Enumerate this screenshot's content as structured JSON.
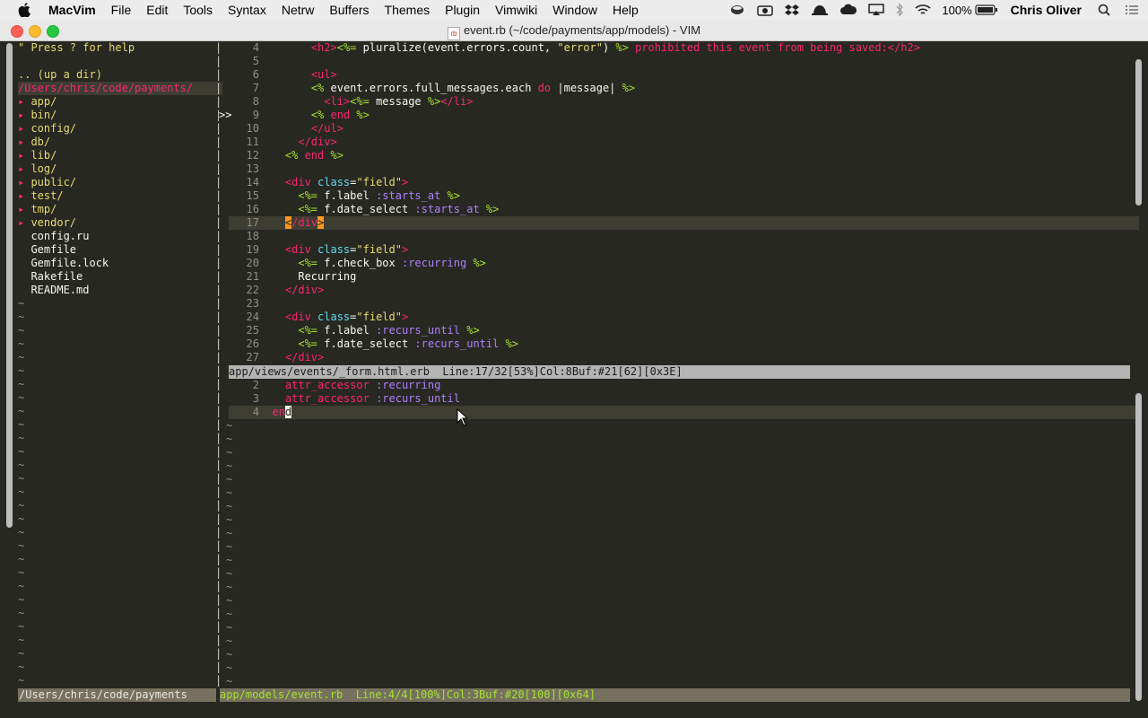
{
  "menubar": {
    "apple": "apple-icon",
    "items": [
      "MacVim",
      "File",
      "Edit",
      "Tools",
      "Syntax",
      "Netrw",
      "Buffers",
      "Themes",
      "Plugin",
      "Vimwiki",
      "Window",
      "Help"
    ],
    "battery": "100%",
    "user": "Chris Oliver"
  },
  "window": {
    "title": "event.rb (~/code/payments/app/models) - VIM",
    "file_badge": "rb"
  },
  "tree": {
    "help": "\" Press ? for help",
    "updir": ".. (up a dir)",
    "root": "/Users/chris/code/payments/",
    "dirs": [
      "app/",
      "bin/",
      "config/",
      "db/",
      "lib/",
      "log/",
      "public/",
      "test/",
      "tmp/",
      "vendor/"
    ],
    "files": [
      "config.ru",
      "Gemfile",
      "Gemfile.lock",
      "Rakefile",
      "README.md"
    ],
    "statusline": "/Users/chris/code/payments"
  },
  "top_buffer": {
    "cursor_marker": ">>",
    "lines": [
      {
        "n": "4",
        "segs": [
          [
            "k-txt",
            "      "
          ],
          [
            "k-tag",
            "<h2>"
          ],
          [
            "k-erb",
            "<%="
          ],
          [
            "k-txt",
            " pluralize(event.errors.count, "
          ],
          [
            "k-str",
            "\"error\""
          ],
          [
            "k-txt",
            ") "
          ],
          [
            "k-erb",
            "%>"
          ],
          [
            "k-red",
            " prohibited this event from being saved:"
          ],
          [
            "k-tag",
            "</h2>"
          ]
        ]
      },
      {
        "n": "5",
        "segs": []
      },
      {
        "n": "6",
        "segs": [
          [
            "k-txt",
            "      "
          ],
          [
            "k-tag",
            "<ul>"
          ]
        ]
      },
      {
        "n": "7",
        "segs": [
          [
            "k-txt",
            "      "
          ],
          [
            "k-erb",
            "<%"
          ],
          [
            "k-txt",
            " event.errors.full_messages.each "
          ],
          [
            "k-kw",
            "do"
          ],
          [
            "k-txt",
            " |message| "
          ],
          [
            "k-erb",
            "%>"
          ]
        ]
      },
      {
        "n": "8",
        "segs": [
          [
            "k-txt",
            "        "
          ],
          [
            "k-tag",
            "<li>"
          ],
          [
            "k-erb",
            "<%="
          ],
          [
            "k-txt",
            " message "
          ],
          [
            "k-erb",
            "%>"
          ],
          [
            "k-tag",
            "</li>"
          ]
        ]
      },
      {
        "n": "9",
        "segs": [
          [
            "k-txt",
            "      "
          ],
          [
            "k-erb",
            "<%"
          ],
          [
            "k-kw",
            " end"
          ],
          [
            "k-erb",
            " %>"
          ]
        ]
      },
      {
        "n": "10",
        "segs": [
          [
            "k-txt",
            "      "
          ],
          [
            "k-tag",
            "</ul>"
          ]
        ]
      },
      {
        "n": "11",
        "segs": [
          [
            "k-txt",
            "    "
          ],
          [
            "k-tag",
            "</div>"
          ]
        ]
      },
      {
        "n": "12",
        "segs": [
          [
            "k-txt",
            "  "
          ],
          [
            "k-erb",
            "<%"
          ],
          [
            "k-kw",
            " end"
          ],
          [
            "k-erb",
            " %>"
          ]
        ]
      },
      {
        "n": "13",
        "segs": []
      },
      {
        "n": "14",
        "segs": [
          [
            "k-txt",
            "  "
          ],
          [
            "k-tag",
            "<div"
          ],
          [
            "k-attr",
            " class"
          ],
          [
            "k-txt",
            "="
          ],
          [
            "k-str",
            "\"field\""
          ],
          [
            "k-tag",
            ">"
          ]
        ]
      },
      {
        "n": "15",
        "segs": [
          [
            "k-txt",
            "    "
          ],
          [
            "k-erb",
            "<%="
          ],
          [
            "k-txt",
            " f.label "
          ],
          [
            "k-sym",
            ":starts_at"
          ],
          [
            "k-erb",
            " %>"
          ]
        ]
      },
      {
        "n": "16",
        "segs": [
          [
            "k-txt",
            "    "
          ],
          [
            "k-erb",
            "<%="
          ],
          [
            "k-txt",
            " f.date_select "
          ],
          [
            "k-sym",
            ":starts_at"
          ],
          [
            "k-erb",
            " %>"
          ]
        ]
      },
      {
        "n": "17",
        "segs": [
          [
            "k-txt",
            "  "
          ],
          [
            "k-hl",
            "<"
          ],
          [
            "k-tag",
            "/div"
          ],
          [
            "k-hl",
            ">"
          ]
        ]
      },
      {
        "n": "18",
        "segs": []
      },
      {
        "n": "19",
        "segs": [
          [
            "k-txt",
            "  "
          ],
          [
            "k-tag",
            "<div"
          ],
          [
            "k-attr",
            " class"
          ],
          [
            "k-txt",
            "="
          ],
          [
            "k-str",
            "\"field\""
          ],
          [
            "k-tag",
            ">"
          ]
        ]
      },
      {
        "n": "20",
        "segs": [
          [
            "k-txt",
            "    "
          ],
          [
            "k-erb",
            "<%="
          ],
          [
            "k-txt",
            " f.check_box "
          ],
          [
            "k-sym",
            ":recurring"
          ],
          [
            "k-erb",
            " %>"
          ]
        ]
      },
      {
        "n": "21",
        "segs": [
          [
            "k-txt",
            "    Recurring"
          ]
        ]
      },
      {
        "n": "22",
        "segs": [
          [
            "k-txt",
            "  "
          ],
          [
            "k-tag",
            "</div>"
          ]
        ]
      },
      {
        "n": "23",
        "segs": []
      },
      {
        "n": "24",
        "segs": [
          [
            "k-txt",
            "  "
          ],
          [
            "k-tag",
            "<div"
          ],
          [
            "k-attr",
            " class"
          ],
          [
            "k-txt",
            "="
          ],
          [
            "k-str",
            "\"field\""
          ],
          [
            "k-tag",
            ">"
          ]
        ]
      },
      {
        "n": "25",
        "segs": [
          [
            "k-txt",
            "    "
          ],
          [
            "k-erb",
            "<%="
          ],
          [
            "k-txt",
            " f.label "
          ],
          [
            "k-sym",
            ":recurs_until"
          ],
          [
            "k-erb",
            " %>"
          ]
        ]
      },
      {
        "n": "26",
        "segs": [
          [
            "k-txt",
            "    "
          ],
          [
            "k-erb",
            "<%="
          ],
          [
            "k-txt",
            " f.date_select "
          ],
          [
            "k-sym",
            ":recurs_until"
          ],
          [
            "k-erb",
            " %>"
          ]
        ]
      },
      {
        "n": "27",
        "segs": [
          [
            "k-txt",
            "  "
          ],
          [
            "k-tag",
            "</div>"
          ]
        ]
      }
    ],
    "statusline": "app/views/events/_form.html.erb  Line:17/32[53%]Col:8Buf:#21[62][0x3E]"
  },
  "bottom_buffer": {
    "lines": [
      {
        "n": "2",
        "segs": [
          [
            "k-txt",
            "  "
          ],
          [
            "k-red",
            "attr_accessor"
          ],
          [
            "k-txt",
            " "
          ],
          [
            "k-sym",
            ":recurring"
          ]
        ]
      },
      {
        "n": "3",
        "segs": [
          [
            "k-txt",
            "  "
          ],
          [
            "k-red",
            "attr_accessor"
          ],
          [
            "k-txt",
            " "
          ],
          [
            "k-sym",
            ":recurs_until"
          ]
        ]
      },
      {
        "n": "4",
        "segs": [
          [
            "k-red",
            "en"
          ],
          [
            "k-cur",
            "d"
          ]
        ]
      }
    ],
    "statusline": "app/models/event.rb  Line:4/4[100%]Col:3Buf:#20[100][0x64]"
  },
  "colors": {
    "background": "#272822",
    "statusline_active": "#b4b4b4",
    "tag": "#f92672",
    "erb": "#a6e22e",
    "string": "#e6db74",
    "symbol": "#ae81ff"
  }
}
